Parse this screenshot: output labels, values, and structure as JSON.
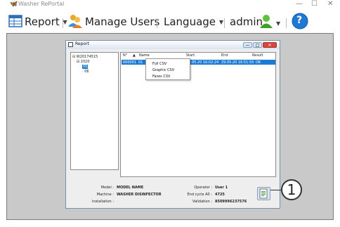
{
  "app": {
    "title": "Washer RePortal",
    "icon": "washer-app-icon"
  },
  "window_controls": {
    "minimize": "—",
    "maximize": "☐",
    "close": "✕"
  },
  "menu": {
    "report_label": "Report",
    "manage_users_label": "Manage Users",
    "language_label": "Language",
    "user_label": "admin",
    "help_label": "?"
  },
  "report_window": {
    "title": "Report",
    "tree": {
      "root": "W20174515",
      "year": "2020",
      "month_selected": "05",
      "month_other": "06"
    },
    "columns": [
      "N°",
      "Name",
      "Start",
      "End",
      "Result"
    ],
    "rows": [
      {
        "num": "000001",
        "name": "01",
        "start": "29.05.20 16:02:24",
        "end": "29.05.20 16:51:55",
        "result": "OK"
      }
    ],
    "context_menu": [
      "Full CSV",
      "Graphic CSV",
      "Fases CSV"
    ],
    "details": {
      "model_label": "Model :",
      "model_value": "MODEL NAME",
      "machine_label": "Machine :",
      "machine_value": "WASHER DISINFECTOR",
      "installation_label": "Installation :",
      "installation_value": "",
      "operator_label": "Operator :",
      "operator_value": "User 1",
      "endcycle_label": "End cycle A0 :",
      "endcycle_value": "4725",
      "validation_label": "Validation :",
      "validation_value": "8509996237576"
    }
  },
  "callout": {
    "number": "1"
  },
  "colors": {
    "selection": "#1b7ad4",
    "workspace": "#c9c9c9",
    "close_button": "#d9463b"
  }
}
